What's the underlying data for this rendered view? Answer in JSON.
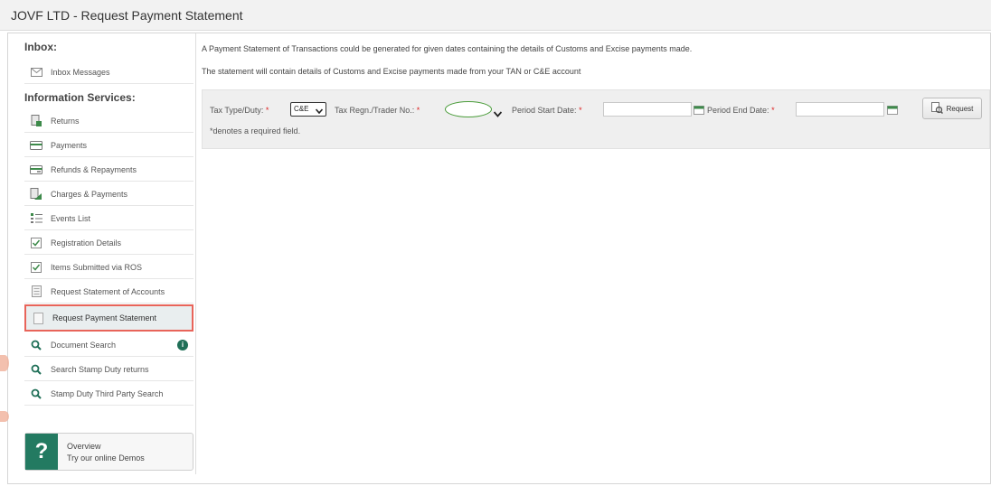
{
  "window": {
    "title": "JOVF LTD - Request Payment Statement"
  },
  "sidebar": {
    "inbox_heading": "Inbox:",
    "inbox_items": [
      {
        "label": "Inbox Messages",
        "icon": "envelope-icon"
      }
    ],
    "info_heading": "Information Services:",
    "items": [
      {
        "label": "Returns",
        "icon": "returns-icon"
      },
      {
        "label": "Payments",
        "icon": "card-icon"
      },
      {
        "label": "Refunds & Repayments",
        "icon": "refund-card-icon"
      },
      {
        "label": "Charges & Payments",
        "icon": "charges-icon"
      },
      {
        "label": "Events List",
        "icon": "list-icon"
      },
      {
        "label": "Registration Details",
        "icon": "checkbox-icon"
      },
      {
        "label": "Items Submitted via ROS",
        "icon": "checkbox-icon"
      },
      {
        "label": "Request Statement of Accounts",
        "icon": "document-icon"
      },
      {
        "label": "Request Payment Statement",
        "icon": "document-icon",
        "active": true
      },
      {
        "label": "Document Search",
        "icon": "search-icon",
        "badge": "i"
      },
      {
        "label": "Search Stamp Duty returns",
        "icon": "search-icon"
      },
      {
        "label": "Stamp Duty Third Party Search",
        "icon": "search-icon"
      }
    ],
    "help": {
      "glyph": "?",
      "line1": "Overview",
      "line2": "Try our online Demos"
    }
  },
  "main": {
    "intro_1": "A Payment Statement of Transactions could be generated for given dates containing the details of Customs and Excise payments made.",
    "intro_2": "The statement will contain details of Customs and Excise payments made from your TAN or C&E account",
    "form": {
      "tax_type_label": "Tax Type/Duty:",
      "tax_type_value": "C&E",
      "trader_label": "Tax Regn./Trader No.:",
      "trader_value": "",
      "start_label": "Period Start Date:",
      "start_value": "",
      "end_label": "Period End Date:",
      "end_value": "",
      "required_mark": "*",
      "request_button": "Request",
      "required_note": "*denotes a required field."
    }
  },
  "colors": {
    "accent": "#237a61",
    "highlight_border": "#e8645a",
    "required": "#dd2222"
  }
}
